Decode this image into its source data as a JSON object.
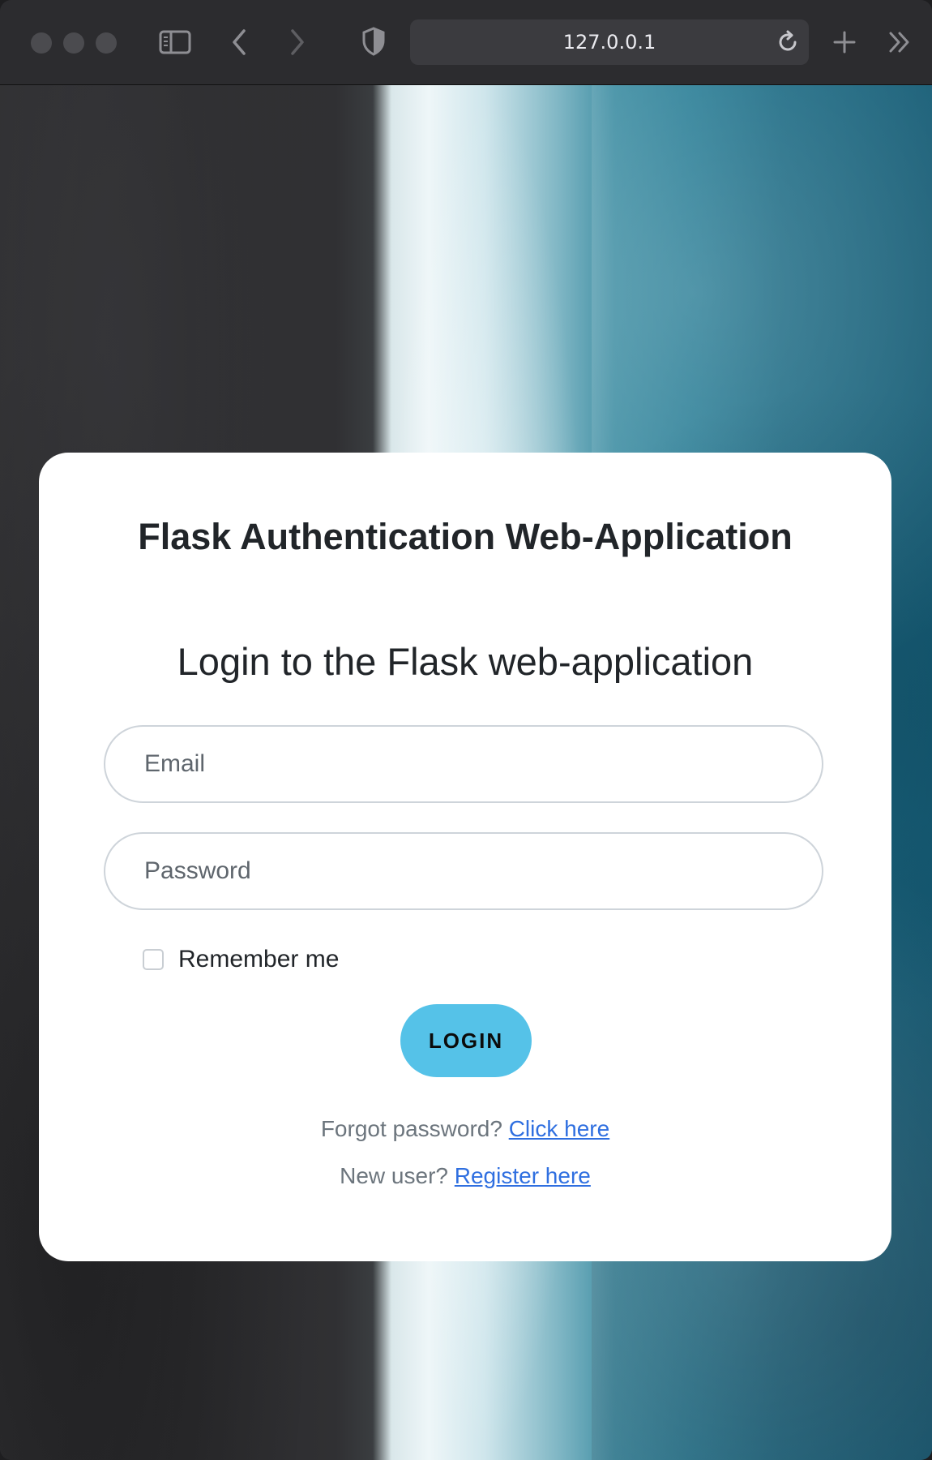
{
  "browser": {
    "url": "127.0.0.1",
    "icons": {
      "sidebar": "sidebar-icon",
      "back": "chevron-left-icon",
      "forward": "chevron-right-icon",
      "privacy": "shield-icon",
      "reload": "reload-icon",
      "new_tab": "plus-icon",
      "more": "double-chevron-right-icon"
    }
  },
  "card": {
    "app_title": "Flask Authentication Web-Application",
    "heading": "Login to the Flask web-application",
    "email_placeholder": "Email",
    "password_placeholder": "Password",
    "remember_label": "Remember me",
    "login_button": "LOGIN",
    "forgot_text": "Forgot password?",
    "forgot_link": "Click here",
    "register_text": "New user?",
    "register_link": "Register here"
  },
  "colors": {
    "accent_button": "#55c2e8",
    "link": "#2f6fe0",
    "card_bg": "#ffffff"
  }
}
